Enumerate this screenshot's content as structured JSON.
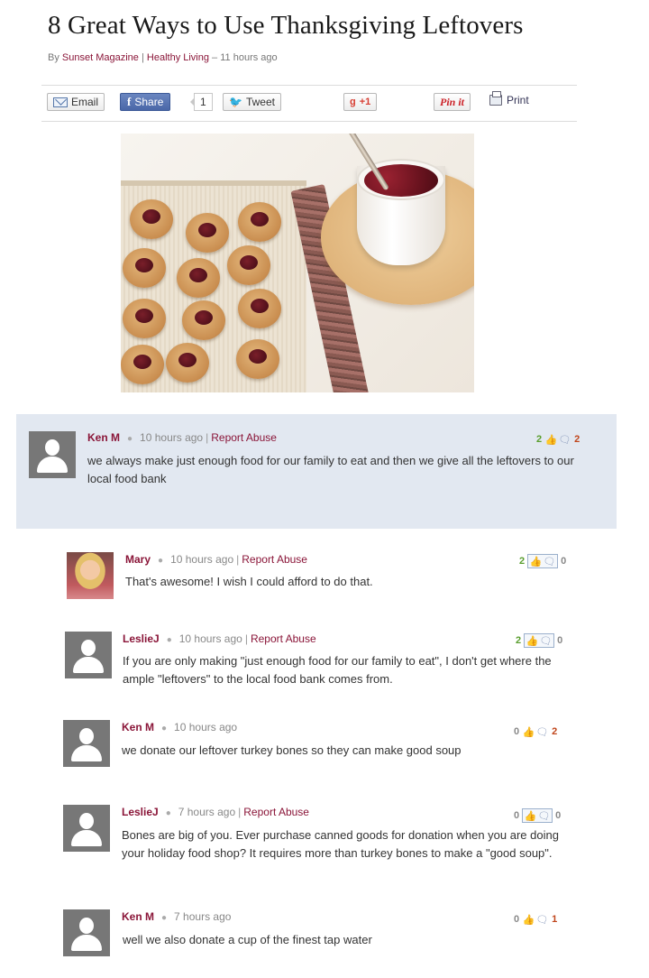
{
  "article": {
    "title": "8 Great Ways to Use Thanksgiving Leftovers",
    "by": "By",
    "source": "Sunset Magazine",
    "section": "Healthy Living",
    "time": "11 hours ago"
  },
  "share": {
    "email": "Email",
    "share": "Share",
    "share_count": "1",
    "tweet": "Tweet",
    "gplus": "+1",
    "pin": "Pin it",
    "print": "Print"
  },
  "comments": [
    {
      "name": "Ken M",
      "time": "10 hours ago",
      "report": "Report Abuse",
      "text": "we always make just enough food for our family to eat and then we give all the leftovers to our local food bank",
      "up": "2",
      "down": "2"
    },
    {
      "name": "Mary",
      "time": "10 hours ago",
      "report": "Report Abuse",
      "text": "That's awesome! I wish I could afford to do that.",
      "up": "2",
      "down": "0"
    },
    {
      "name": "LeslieJ",
      "time": "10 hours ago",
      "report": "Report Abuse",
      "text": "If you are only making \"just enough food for our family to eat\", I don't get where the ample \"leftovers\" to the local food bank comes from.",
      "up": "2",
      "down": "0"
    },
    {
      "name": "Ken M",
      "time": "10 hours ago",
      "text": "we donate our leftover turkey bones so they can make good soup",
      "up": "0",
      "down": "2"
    },
    {
      "name": "LeslieJ",
      "time": "7 hours ago",
      "report": "Report Abuse",
      "text": "Bones are big of you. Ever purchase canned goods for donation when you are doing your holiday food shop? It requires more than turkey bones to make a \"good soup\".",
      "up": "0",
      "down": "0"
    },
    {
      "name": "Ken M",
      "time": "7 hours ago",
      "text": "well we also donate a cup of the finest tap water",
      "up": "0",
      "down": "1"
    }
  ],
  "colors": {
    "link": "#8a1538",
    "highlight_bg": "#e2e8f1",
    "vote_up": "#5a9e2f",
    "vote_down": "#c0461c"
  },
  "icons": [
    "mail-icon",
    "facebook-icon",
    "twitter-icon",
    "google-plus-icon",
    "pinterest-icon",
    "print-icon",
    "thumbs-up-icon",
    "reply-bubble-icon",
    "avatar-icon"
  ]
}
